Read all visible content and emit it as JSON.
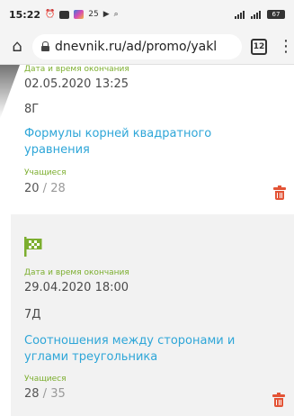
{
  "status_bar": {
    "time": "15:22",
    "notification_count": "25",
    "battery": "67"
  },
  "browser": {
    "url": "dnevnik.ru/ad/promo/yakl",
    "tab_count": "12"
  },
  "cards": [
    {
      "end_label": "Дата и время окончания",
      "end_datetime": "02.05.2020 13:25",
      "class_name": "8Г",
      "topic": "Формулы корней квадратного уравнения",
      "topic_line1": "Формулы корней квадратного",
      "topic_line2": "уравнения",
      "students_label": "Учащиеся",
      "students_done": "20",
      "students_total": "28"
    },
    {
      "end_label": "Дата и время окончания",
      "end_datetime": "29.04.2020 18:00",
      "class_name": "7Д",
      "topic": "Соотношения между сторонами и углами треугольника",
      "topic_line1": "Соотношения между сторонами и",
      "topic_line2": "углами треугольника",
      "students_label": "Учащиеся",
      "students_done": "28",
      "students_total": "35"
    }
  ],
  "colors": {
    "label_green": "#7cae2f",
    "link_blue": "#2ea6d8",
    "delete_red": "#e35436"
  }
}
